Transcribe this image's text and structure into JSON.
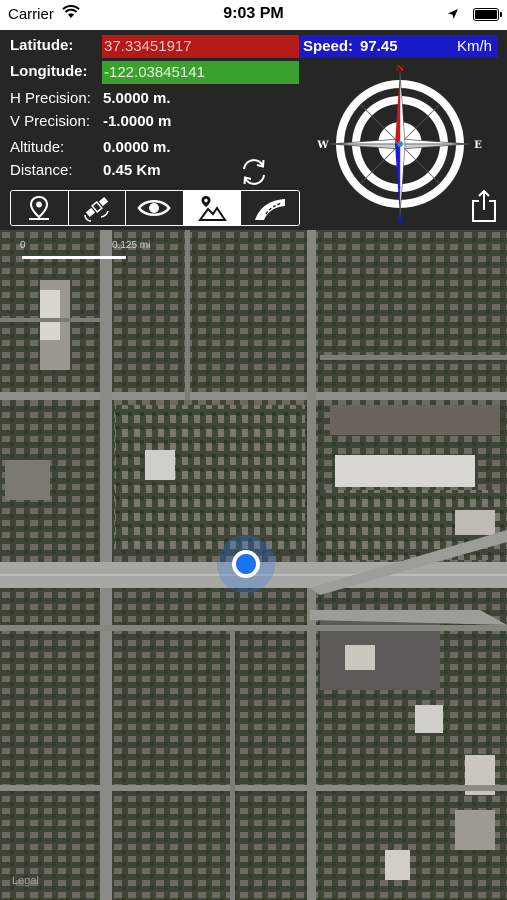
{
  "status_bar": {
    "carrier": "Carrier",
    "time": "9:03 PM"
  },
  "coords": {
    "latitude_label": "Latitude:",
    "latitude_value": "37.33451917",
    "longitude_label": "Longitude:",
    "longitude_value": "-122.03845141"
  },
  "speed": {
    "label": "Speed:",
    "value": "97.45",
    "unit": "Km/h"
  },
  "details": [
    {
      "label": "H Precision:",
      "value": "5.0000 m."
    },
    {
      "label": "V Precision:",
      "value": "-1.0000 m"
    },
    {
      "label": "Altitude:",
      "value": "0.0000 m."
    },
    {
      "label": "Distance:",
      "value": "0.45 Km"
    }
  ],
  "compass": {
    "north": "N",
    "south": "S",
    "east": "E",
    "west": "W"
  },
  "toolbar": {
    "buttons": [
      {
        "icon": "map-pin-icon",
        "active": false
      },
      {
        "icon": "satellite-icon",
        "active": false
      },
      {
        "icon": "eye-icon",
        "active": false
      },
      {
        "icon": "hybrid-map-icon",
        "active": true
      },
      {
        "icon": "road-icon",
        "active": false
      }
    ]
  },
  "map": {
    "scale_start": "0",
    "scale_end": "0.125 mi",
    "legal": "Legal"
  },
  "colors": {
    "latitude_bg": "#b51a16",
    "longitude_bg": "#3aa02e",
    "speed_bg": "#1a1ac8",
    "location_dot": "#1d72f2"
  }
}
